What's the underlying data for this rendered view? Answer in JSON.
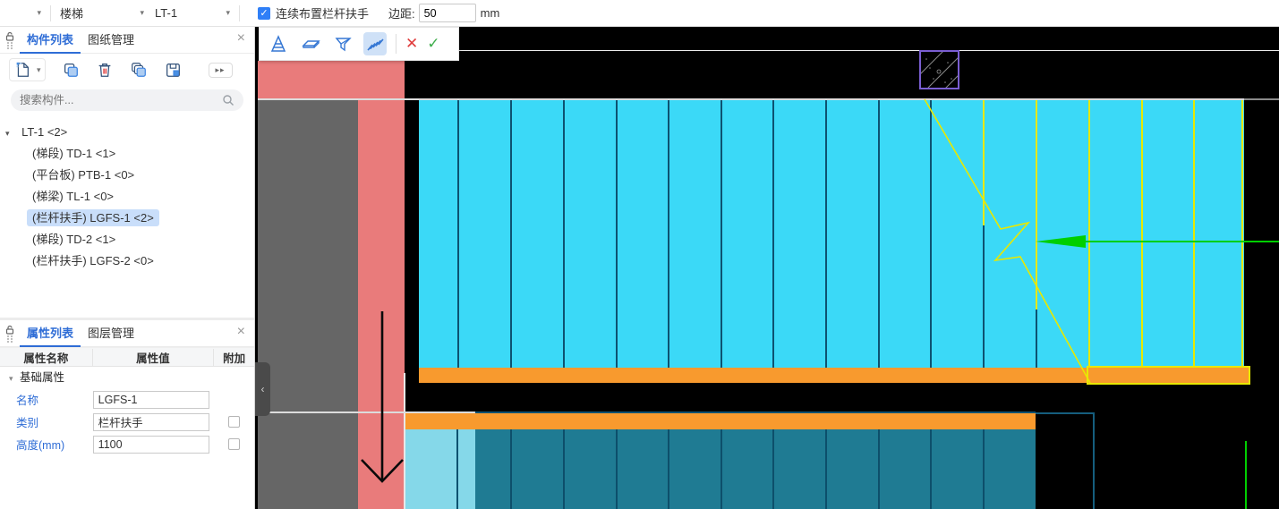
{
  "app": {
    "caret": "▾",
    "close_glyph": "×",
    "check_glyph": "✓",
    "collapse_glyph": "‹",
    "more_glyph": "▸▸"
  },
  "header": {
    "empty_dropdown_value": "",
    "category_value": "楼梯",
    "component_value": "LT-1",
    "continuous_label": "连续布置栏杆扶手",
    "continuous_checked": true,
    "margin_label": "边距:",
    "margin_value": "50",
    "margin_unit": "mm"
  },
  "component_panel": {
    "tab_components": "构件列表",
    "tab_drawings": "图纸管理",
    "search_placeholder": "搜索构件...",
    "tree": [
      {
        "label": "LT-1 <2>",
        "level": 0,
        "expanded": true,
        "selected": false
      },
      {
        "label": "(梯段) TD-1 <1>",
        "level": 1,
        "selected": false
      },
      {
        "label": "(平台板) PTB-1 <0>",
        "level": 1,
        "selected": false
      },
      {
        "label": "(梯梁) TL-1 <0>",
        "level": 1,
        "selected": false
      },
      {
        "label": "(栏杆扶手) LGFS-1 <2>",
        "level": 1,
        "selected": true
      },
      {
        "label": "(梯段) TD-2 <1>",
        "level": 1,
        "selected": false
      },
      {
        "label": "(栏杆扶手) LGFS-2 <0>",
        "level": 1,
        "selected": false
      }
    ]
  },
  "property_panel": {
    "tab_properties": "属性列表",
    "tab_layers": "图层管理",
    "col_name": "属性名称",
    "col_value": "属性值",
    "col_attach": "附加",
    "group_label": "基础属性",
    "rows": [
      {
        "name": "名称",
        "value": "LGFS-1",
        "has_checkbox": false,
        "checked": false
      },
      {
        "name": "类别",
        "value": "栏杆扶手",
        "has_checkbox": true,
        "checked": false
      },
      {
        "name": "高度(mm)",
        "value": "1100",
        "has_checkbox": true,
        "checked": false
      }
    ]
  },
  "canvas_toolbar": {
    "cancel_glyph": "✕",
    "confirm_glyph": "✓"
  },
  "colors": {
    "accent_blue": "#2f6dd6",
    "selection_blue": "#c9defa",
    "cyan": "#3bd9f7",
    "teal_flight": "#1f7b93",
    "divider_teal": "#0d5271",
    "light_blue_tread": "#85d8e9",
    "orange": "#f89a2e",
    "red_band": "#e97b7b",
    "gray_region": "#666666",
    "yellow": "#e8e800",
    "green": "#00cf00",
    "purple": "#7a5ed2",
    "checkbox_blue": "#2f7ff7"
  }
}
